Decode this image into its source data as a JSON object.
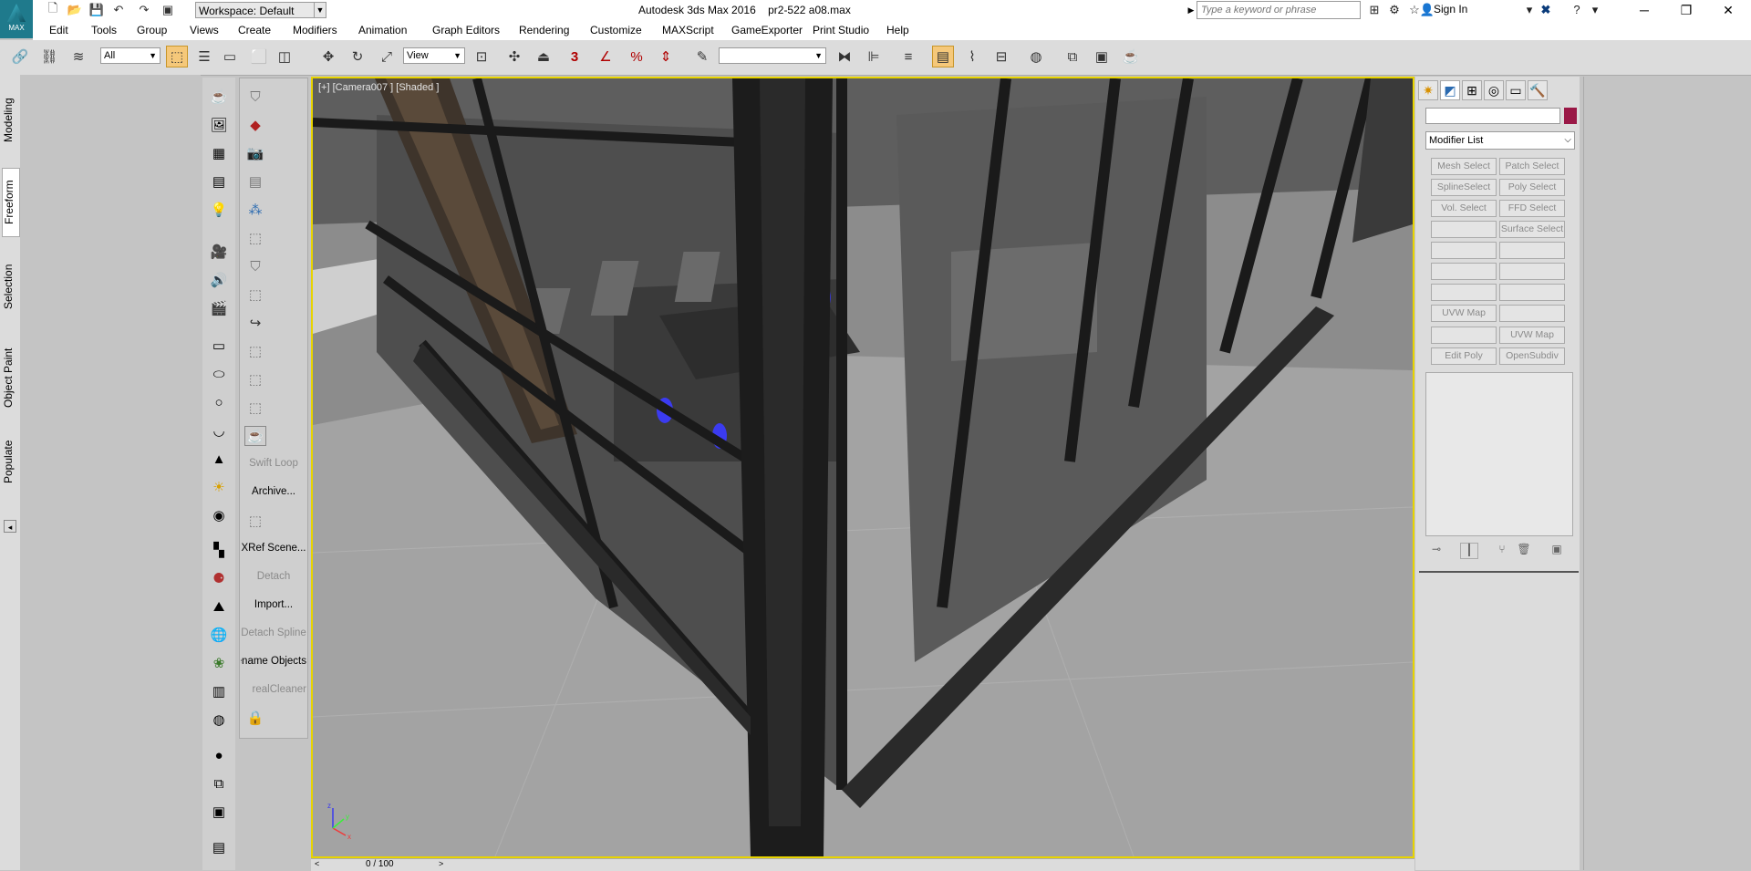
{
  "app": {
    "logo_text": "MAX",
    "title": "Autodesk 3ds Max 2016",
    "file": "pr2-522 a08.max"
  },
  "workspace": {
    "label": "Workspace: Default"
  },
  "search": {
    "placeholder": "Type a keyword or phrase"
  },
  "signin": {
    "label": "Sign In"
  },
  "menu": [
    "Edit",
    "Tools",
    "Group",
    "Views",
    "Create",
    "Modifiers",
    "Animation",
    "Graph Editors",
    "Rendering",
    "Customize",
    "MAXScript",
    "GameExporter",
    "Print Studio",
    "Help"
  ],
  "toolbar": {
    "selection_filter": "All",
    "ref_coord": "View",
    "snap_label": "3",
    "named_sel": ""
  },
  "ribbon": {
    "tabs": [
      "Modeling",
      "Freeform",
      "Selection",
      "Object Paint",
      "Populate"
    ],
    "active": "Freeform"
  },
  "command_column": {
    "labels": [
      "Swift Loop",
      "Archive...",
      "XRef Scene...",
      "Detach",
      "Import...",
      "Detach Spline",
      "Rename Objects",
      "realCleaner"
    ],
    "label_states": [
      "disabled",
      "enabled",
      "enabled",
      "disabled",
      "enabled",
      "disabled",
      "enabled",
      "disabled"
    ]
  },
  "viewport": {
    "label": "[+] [Camera007 ] [Shaded ]"
  },
  "timeline": {
    "frame": "0 / 100"
  },
  "command_panel": {
    "modifier_list": "Modifier List",
    "buttons": [
      [
        "Mesh Select",
        "Patch Select"
      ],
      [
        "SplineSelect",
        "Poly Select"
      ],
      [
        "Vol. Select",
        "FFD Select"
      ],
      [
        "",
        "Surface Select"
      ],
      [
        "",
        ""
      ],
      [
        "",
        ""
      ],
      [
        "",
        ""
      ],
      [
        "UVW Map",
        ""
      ],
      [
        "",
        "UVW Map"
      ],
      [
        "Edit Poly",
        "OpenSubdiv"
      ]
    ],
    "object_color": "#9a1846"
  },
  "colors": {
    "viewport_border": "#e8d400",
    "highlight": "#f5c87a",
    "chair_accent": "#3b3bf0"
  }
}
